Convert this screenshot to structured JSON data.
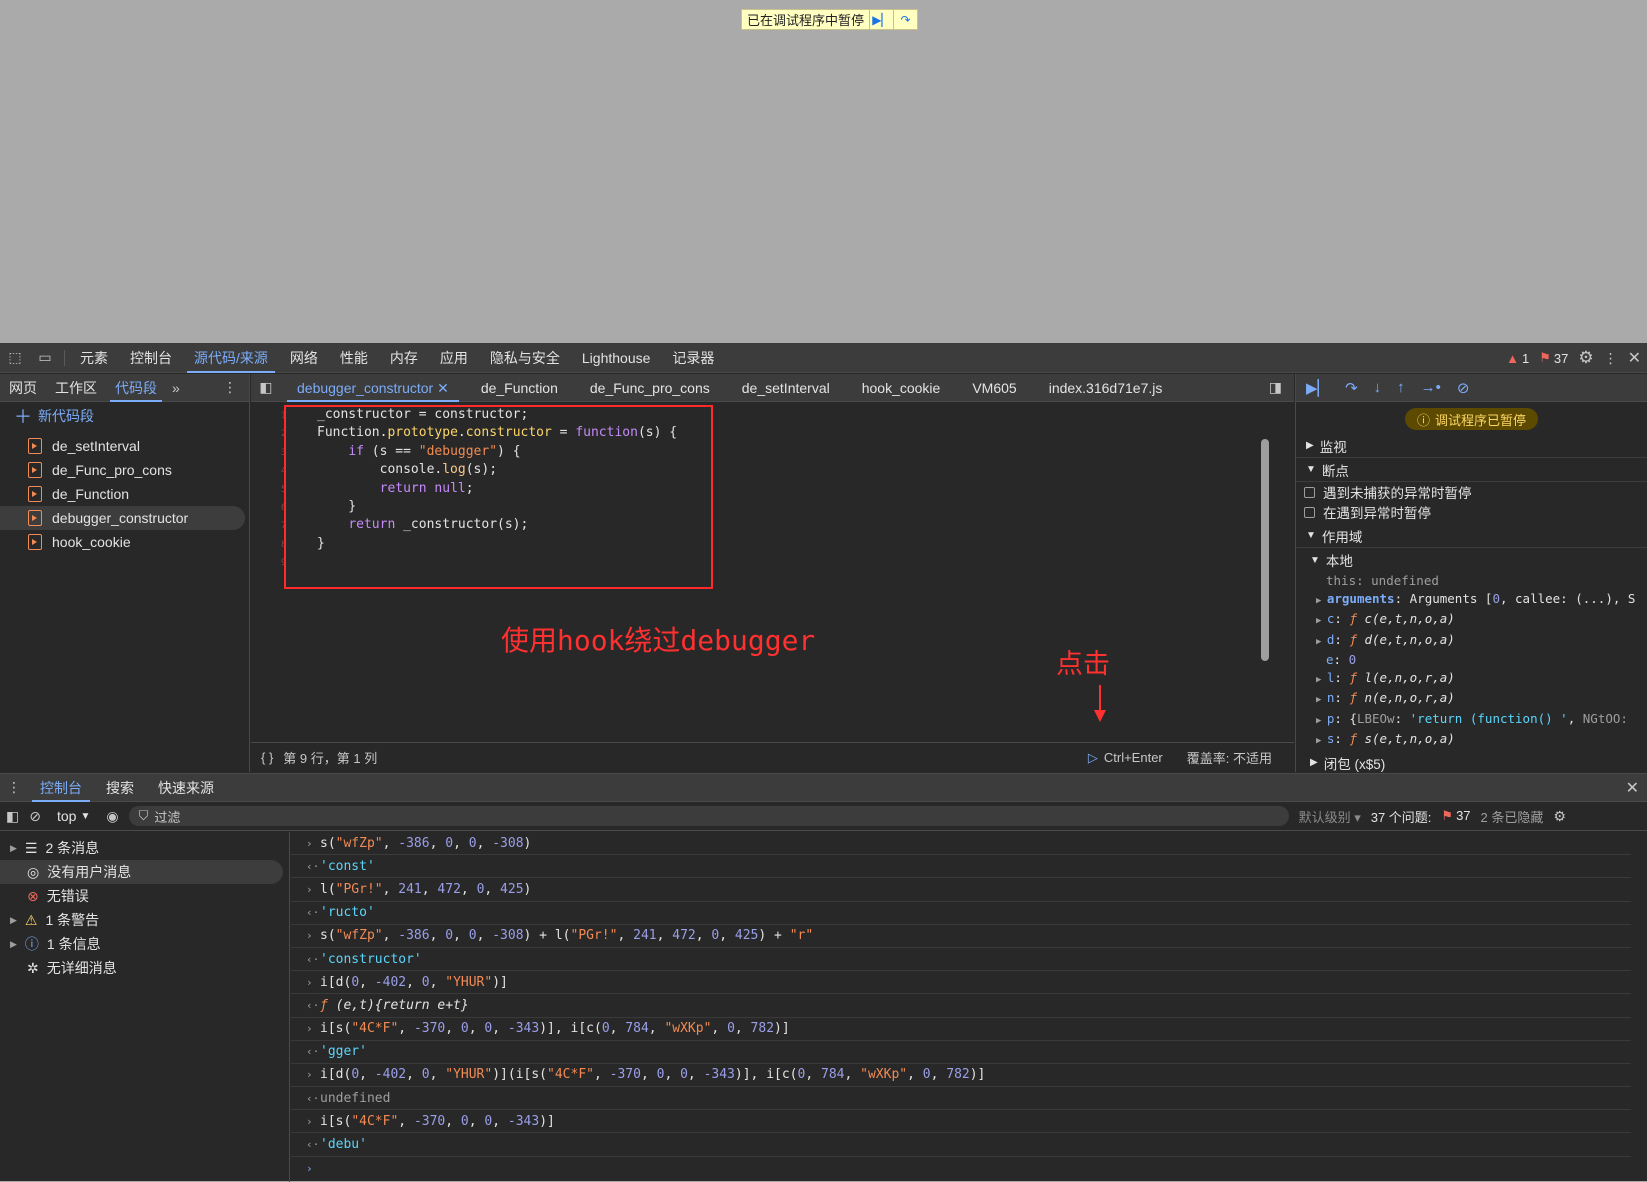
{
  "overlay": {
    "paused_text": "已在调试程序中暂停"
  },
  "main_tabs": [
    "元素",
    "控制台",
    "源代码/来源",
    "网络",
    "性能",
    "内存",
    "应用",
    "隐私与安全",
    "Lighthouse",
    "记录器"
  ],
  "issues": {
    "warnings": "1",
    "messages": "37"
  },
  "navigator": {
    "tabs": [
      "网页",
      "工作区",
      "代码段"
    ],
    "new_snippet": "新代码段",
    "snippets": [
      "de_setInterval",
      "de_Func_pro_cons",
      "de_Function",
      "debugger_constructor",
      "hook_cookie"
    ]
  },
  "editor": {
    "tabs": [
      "debugger_constructor",
      "de_Function",
      "de_Func_pro_cons",
      "de_setInterval",
      "hook_cookie",
      "VM605",
      "index.316d71e7.js"
    ],
    "line_numbers": [
      "1",
      "2",
      "3",
      "4",
      "5",
      "6",
      "7",
      "8",
      "9"
    ],
    "annotation_hook": "使用hook绕过debugger",
    "annotation_click": "点击",
    "status_position": "第 9 行，第 1 列",
    "run_shortcut": "Ctrl+Enter",
    "coverage": "覆盖率: 不适用"
  },
  "debugger": {
    "paused": "调试程序已暂停",
    "watch": "监视",
    "breakpoints": "断点",
    "pause_uncaught": "遇到未捕获的异常时暂停",
    "pause_caught": "在遇到异常时暂停",
    "scope": "作用域",
    "local": "本地",
    "closure": "闭包 (x$5)"
  },
  "drawer": {
    "tabs": [
      "控制台",
      "搜索",
      "快速来源"
    ],
    "context": "top",
    "filter_placeholder": "过滤",
    "level": "默认级别",
    "issues_label": "37 个问题:",
    "issues_count": "37",
    "hidden": "2 条已隐藏",
    "sidebar": [
      "2 条消息",
      "没有用户消息",
      "无错误",
      "1 条警告",
      "1 条信息",
      "无详细消息"
    ]
  },
  "colors": {
    "accent": "#7cacf8",
    "annotation": "#ff3030",
    "string": "#f28b54",
    "keyword": "#c58af9"
  }
}
